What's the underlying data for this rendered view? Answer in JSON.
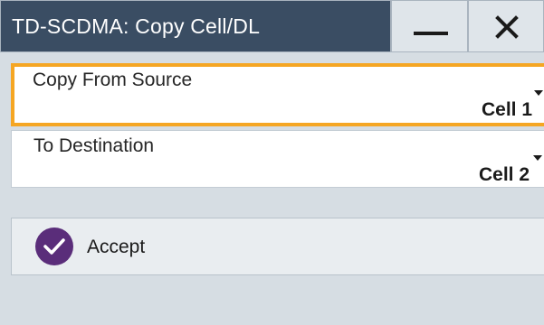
{
  "window": {
    "title": "TD-SCDMA: Copy Cell/DL"
  },
  "fields": {
    "source": {
      "label": "Copy From Source",
      "value": "Cell 1"
    },
    "destination": {
      "label": "To Destination",
      "value": "Cell 2"
    }
  },
  "actions": {
    "accept_label": "Accept"
  },
  "icons": {
    "minimize": "minimize-icon",
    "close": "close-icon",
    "dropdown": "dropdown-arrow-icon",
    "accept": "checkmark-icon"
  },
  "colors": {
    "titlebar": "#3a4d63",
    "focus_border": "#f5a623",
    "accept_icon": "#5a2d7a"
  }
}
